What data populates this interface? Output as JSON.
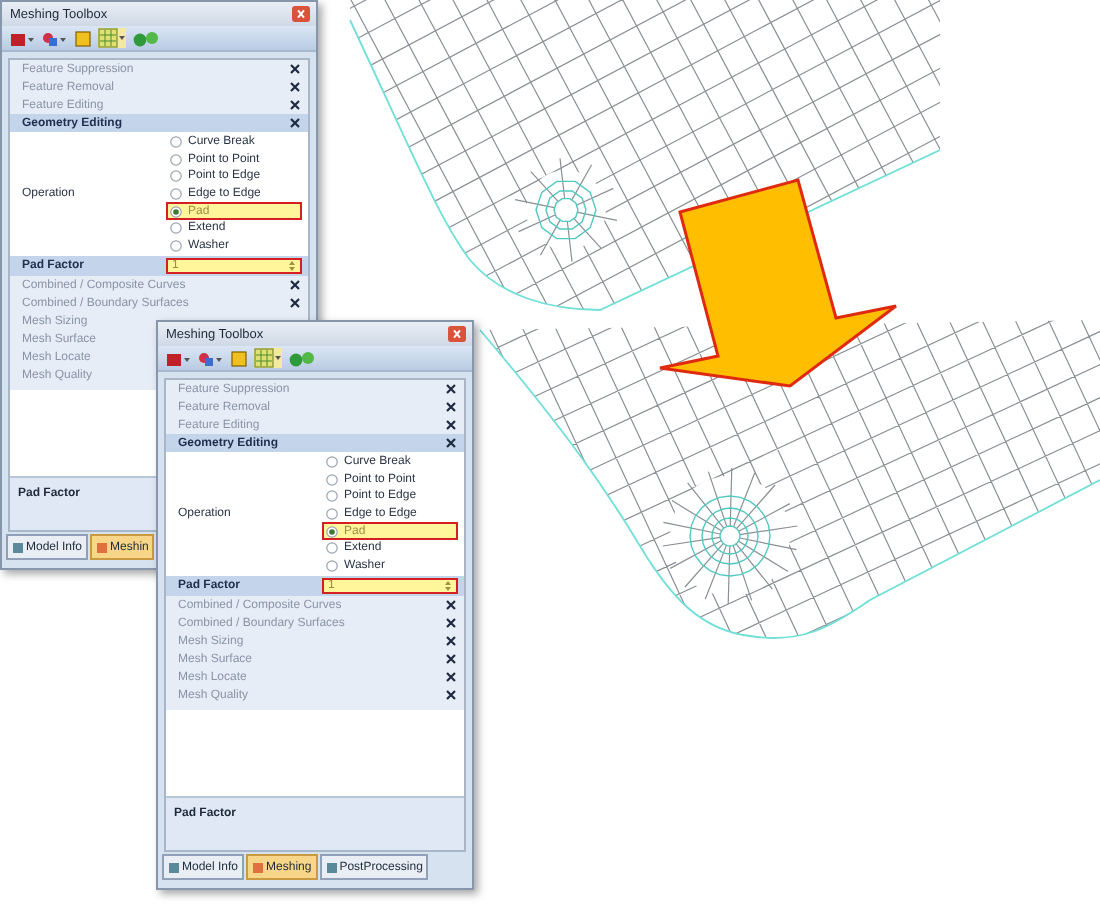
{
  "windows": [
    {
      "title": "Meshing Toolbox",
      "sections": [
        {
          "label": "Feature Suppression"
        },
        {
          "label": "Feature Removal"
        },
        {
          "label": "Feature Editing"
        }
      ],
      "geometry": {
        "label": "Geometry Editing",
        "operation_label": "Operation"
      },
      "options": [
        {
          "label": "Curve Break",
          "selected": false,
          "highlighted": false
        },
        {
          "label": "Point to Point",
          "selected": false,
          "highlighted": false
        },
        {
          "label": "Point to Edge",
          "selected": false,
          "highlighted": false
        },
        {
          "label": "Edge to Edge",
          "selected": false,
          "highlighted": false
        },
        {
          "label": "Pad",
          "selected": true,
          "highlighted": true
        },
        {
          "label": "Extend",
          "selected": false,
          "highlighted": false
        },
        {
          "label": "Washer",
          "selected": false,
          "highlighted": false
        }
      ],
      "pad_factor": {
        "label": "Pad Factor",
        "value": "1",
        "highlighted": true
      },
      "sections_after": [
        {
          "label": "Combined / Composite Curves"
        },
        {
          "label": "Combined / Boundary Surfaces"
        },
        {
          "label": "Mesh Sizing"
        },
        {
          "label": "Mesh Surface"
        },
        {
          "label": "Mesh Locate"
        },
        {
          "label": "Mesh Quality"
        }
      ],
      "description": "Pad Factor",
      "tabs": [
        {
          "label": "Model Info",
          "selected": false
        },
        {
          "label": "Meshin",
          "selected": true
        }
      ]
    },
    {
      "title": "Meshing Toolbox",
      "sections": [
        {
          "label": "Feature Suppression"
        },
        {
          "label": "Feature Removal"
        },
        {
          "label": "Feature Editing"
        }
      ],
      "geometry": {
        "label": "Geometry Editing",
        "operation_label": "Operation"
      },
      "options": [
        {
          "label": "Curve Break",
          "selected": false,
          "highlighted": false
        },
        {
          "label": "Point to Point",
          "selected": false,
          "highlighted": false
        },
        {
          "label": "Point to Edge",
          "selected": false,
          "highlighted": false
        },
        {
          "label": "Edge to Edge",
          "selected": false,
          "highlighted": false
        },
        {
          "label": "Pad",
          "selected": true,
          "highlighted": true
        },
        {
          "label": "Extend",
          "selected": false,
          "highlighted": false
        },
        {
          "label": "Washer",
          "selected": false,
          "highlighted": false
        }
      ],
      "pad_factor": {
        "label": "Pad Factor",
        "value": "1",
        "highlighted": true
      },
      "sections_after": [
        {
          "label": "Combined / Composite Curves"
        },
        {
          "label": "Combined / Boundary Surfaces"
        },
        {
          "label": "Mesh Sizing"
        },
        {
          "label": "Mesh Surface"
        },
        {
          "label": "Mesh Locate"
        },
        {
          "label": "Mesh Quality"
        }
      ],
      "description": "Pad Factor",
      "tabs": [
        {
          "label": "Model Info",
          "selected": false
        },
        {
          "label": "Meshing",
          "selected": true
        },
        {
          "label": "PostProcessing",
          "selected": false
        }
      ]
    }
  ]
}
